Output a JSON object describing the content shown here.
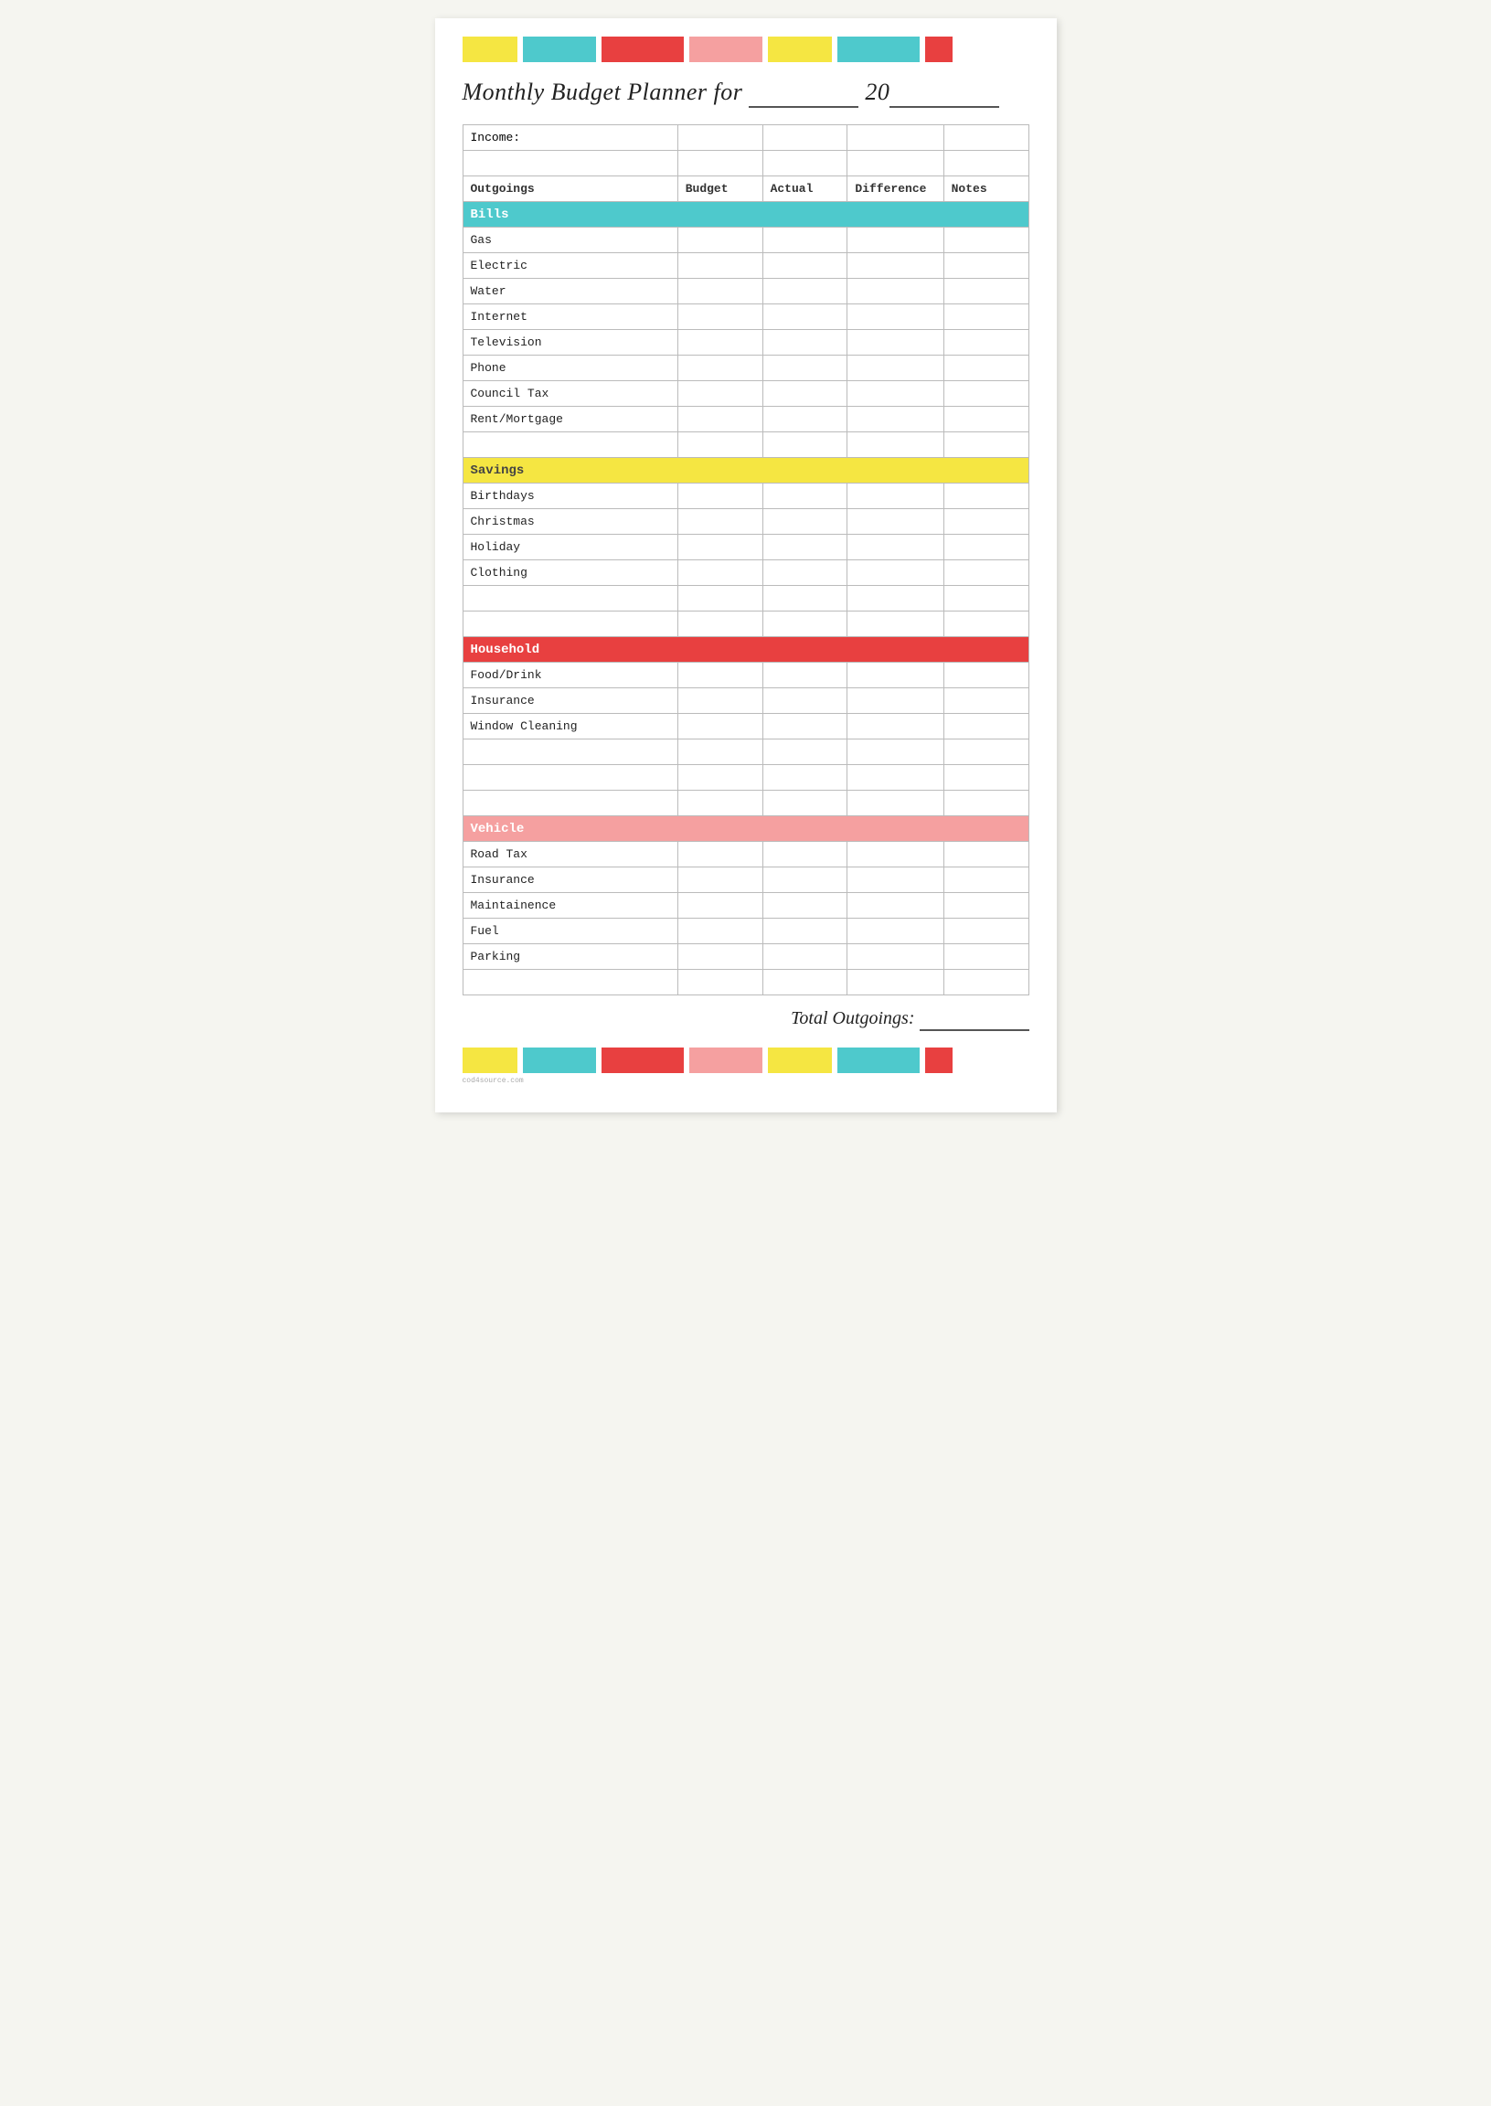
{
  "title": {
    "prefix": "Monthly Budget Planner for",
    "year_prefix": "20"
  },
  "table": {
    "income_label": "Income:",
    "headers": {
      "outgoings": "Outgoings",
      "budget": "Budget",
      "actual": "Actual",
      "difference": "Difference",
      "notes": "Notes"
    },
    "sections": [
      {
        "id": "bills",
        "label": "Bills",
        "color_class": "bills",
        "items": [
          "Gas",
          "Electric",
          "Water",
          "Internet",
          "Television",
          "Phone",
          "Council Tax",
          "Rent/Mortgage",
          ""
        ]
      },
      {
        "id": "savings",
        "label": "Savings",
        "color_class": "savings",
        "items": [
          "Birthdays",
          "Christmas",
          "Holiday",
          "Clothing",
          "",
          ""
        ]
      },
      {
        "id": "household",
        "label": "Household",
        "color_class": "household",
        "items": [
          "Food/Drink",
          "Insurance",
          "Window Cleaning",
          "",
          "",
          ""
        ]
      },
      {
        "id": "vehicle",
        "label": "Vehicle",
        "color_class": "vehicle",
        "items": [
          "Road Tax",
          "Insurance",
          "Maintainence",
          "Fuel",
          "Parking",
          ""
        ]
      }
    ],
    "total_label": "Total Outgoings:"
  },
  "colors": {
    "yellow": "#f5e642",
    "teal": "#4ec9cc",
    "red": "#e84040",
    "pink": "#f5a0a0"
  },
  "watermark": "cod4source.com"
}
